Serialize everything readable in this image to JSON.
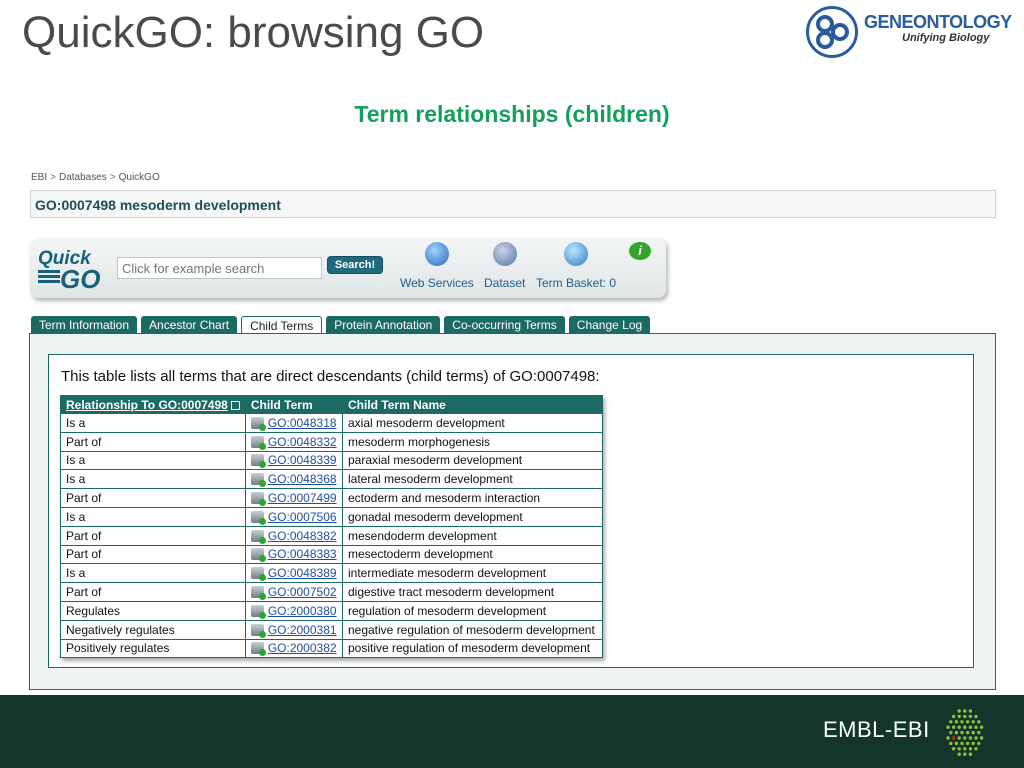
{
  "slide": {
    "title": "QuickGO: browsing GO",
    "subtitle": "Term relationships (children)"
  },
  "go_logo": {
    "brand_part1": "GENE",
    "brand_part2": "ONTOLOGY",
    "tagline": "Unifying Biology",
    "color": "#2a5b9c"
  },
  "breadcrumb": [
    "EBI",
    "Databases",
    "QuickGO"
  ],
  "breadcrumb_sep": ">",
  "term_header": "GO:0007498 mesoderm development",
  "toolbar": {
    "logo_line1": "Quick",
    "logo_line2": "GO",
    "search_placeholder": "Click for example search",
    "search_button": "Search!",
    "web_services": "Web Services",
    "dataset": "Dataset",
    "term_basket": "Term Basket: 0",
    "info": "i"
  },
  "tabs": [
    {
      "label": "Term Information",
      "active": false
    },
    {
      "label": "Ancestor Chart",
      "active": false
    },
    {
      "label": "Child Terms",
      "active": true
    },
    {
      "label": "Protein Annotation",
      "active": false
    },
    {
      "label": "Co-occurring Terms",
      "active": false
    },
    {
      "label": "Change Log",
      "active": false
    }
  ],
  "intro_text": "This table lists all terms that are direct descendants (child terms) of GO:0007498:",
  "table": {
    "headers": [
      "Relationship To GO:0007498",
      "Child Term",
      "Child Term Name"
    ],
    "rows": [
      {
        "relationship": "Is a",
        "id": "GO:0048318",
        "name": "axial mesoderm development"
      },
      {
        "relationship": "Part of",
        "id": "GO:0048332",
        "name": "mesoderm morphogenesis"
      },
      {
        "relationship": "Is a",
        "id": "GO:0048339",
        "name": "paraxial mesoderm development"
      },
      {
        "relationship": "Is a",
        "id": "GO:0048368",
        "name": "lateral mesoderm development"
      },
      {
        "relationship": "Part of",
        "id": "GO:0007499",
        "name": "ectoderm and mesoderm interaction"
      },
      {
        "relationship": "Is a",
        "id": "GO:0007506",
        "name": "gonadal mesoderm development"
      },
      {
        "relationship": "Part of",
        "id": "GO:0048382",
        "name": "mesendoderm development"
      },
      {
        "relationship": "Part of",
        "id": "GO:0048383",
        "name": "mesectoderm development"
      },
      {
        "relationship": "Is a",
        "id": "GO:0048389",
        "name": "intermediate mesoderm development"
      },
      {
        "relationship": "Part of",
        "id": "GO:0007502",
        "name": "digestive tract mesoderm development"
      },
      {
        "relationship": "Regulates",
        "id": "GO:2000380",
        "name": "regulation of mesoderm development"
      },
      {
        "relationship": "Negatively regulates",
        "id": "GO:2000381",
        "name": "negative regulation of mesoderm development"
      },
      {
        "relationship": "Positively regulates",
        "id": "GO:2000382",
        "name": "positive regulation of mesoderm development"
      }
    ]
  },
  "footer": {
    "label": "EMBL-EBI",
    "color": "#14352a"
  },
  "colors": {
    "accent_green": "#13a05a",
    "tab_teal": "#1d6a64",
    "link_blue": "#1e4fa6"
  },
  "icons": [
    "go-logo-icon",
    "quickgo-logo-icon",
    "web-services-globe-icon",
    "dataset-icon",
    "term-basket-icon",
    "info-icon",
    "basket-add-icon",
    "external-link-icon",
    "embl-dots-icon"
  ]
}
